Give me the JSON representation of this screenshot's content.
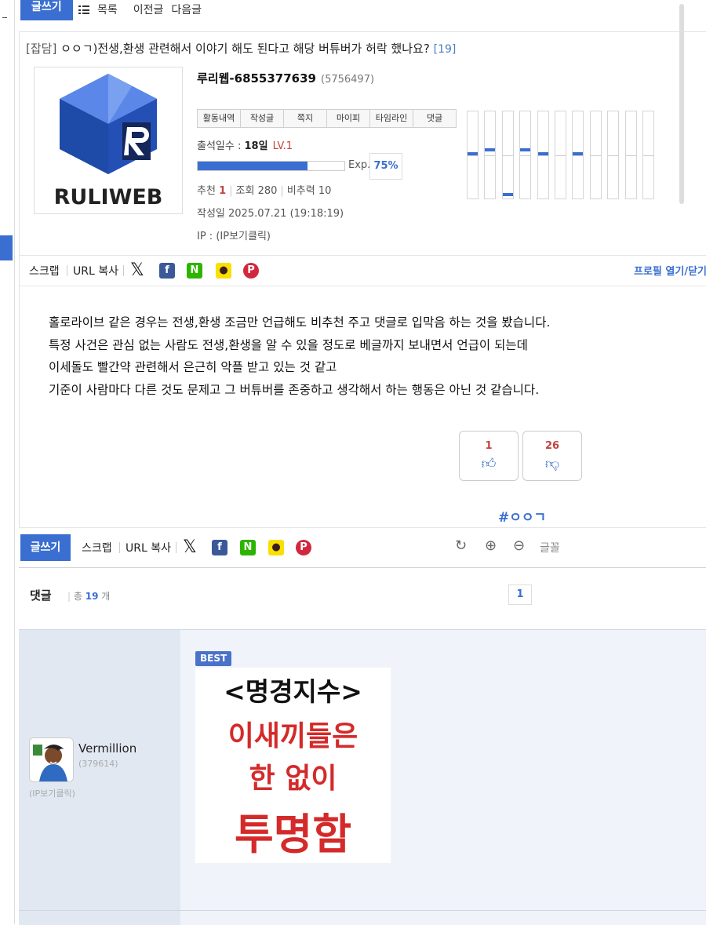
{
  "toolbar": {
    "write_label": "글쓰기",
    "list_label": "목록",
    "prev_label": "이전글",
    "next_label": "다음글"
  },
  "post": {
    "category": "[잡담]",
    "title": "ㅇㅇㄱ)전생,환생 관련해서 이야기 해도 된다고 해당 버튜버가 허락 했나요?",
    "comment_count_badge": "[19]",
    "logo_text": "RULIWEB",
    "author": {
      "nickname": "루리웹-6855377639",
      "uid": "(5756497)"
    },
    "profile_tabs": [
      "활동내역",
      "작성글",
      "쪽지",
      "마이피",
      "타임라인",
      "댓글"
    ],
    "attend_label": "출석일수 : ",
    "attend_days": "18일",
    "level": "LV.1",
    "exp_label": "Exp.",
    "exp_percent": "75%",
    "exp_fraction": 0.75,
    "stats": {
      "recommend_label": "추천",
      "recommend": "1",
      "views_label": "조회",
      "views": "280",
      "nonrec_label": "비추력",
      "nonrec": "10"
    },
    "date": "작성일 2025.07.21 (19:18:19)",
    "ip": "IP : (IP보기클릭)",
    "activity_levels": [
      0.5,
      0.46,
      0.97,
      0.46,
      0.5,
      0,
      0.5,
      0,
      0,
      0,
      0
    ],
    "body_lines": [
      "홀로라이브 같은 경우는 전생,환생 조금만 언급해도 비추천 주고 댓글로 입막음 하는 것을 봤습니다.",
      "특정 사건은 관심 없는 사람도 전생,환생을 알 수 있을 정도로 베글까지 보내면서 언급이 되는데",
      "이세돌도 빨간약 관련해서 은근히 악플 받고 있는 것 같고",
      "기준이 사람마다 다른 것도 문제고 그 버튜버를 존중하고 생각해서 하는 행동은 아닌 것 같습니다."
    ],
    "upvotes": "1",
    "downvotes": "26",
    "tag": "#ㅇㅇㄱ"
  },
  "share": {
    "scrap_label": "스크랩",
    "url_label": "URL 복사",
    "profile_link": "프로필 열기/닫기"
  },
  "bottom": {
    "write_label": "글쓰기",
    "scrap_label": "스크랩",
    "url_label": "URL 복사",
    "font_label": "글꼴"
  },
  "comments": {
    "header": "댓글",
    "count_prefix": "총",
    "count": "19",
    "count_suffix": "개",
    "page": "1",
    "items": [
      {
        "badge": "BEST",
        "nickname": "Vermillion",
        "uid": "(379614)",
        "ip": "(IP보기클릭)",
        "image_lines": [
          "<명경지수>",
          "이새끼들은",
          "한 없이",
          "투명함"
        ]
      }
    ]
  },
  "colors": {
    "accent": "#3a6fd1",
    "danger": "#c0453c",
    "comment_bg": "#f0f4fa"
  }
}
